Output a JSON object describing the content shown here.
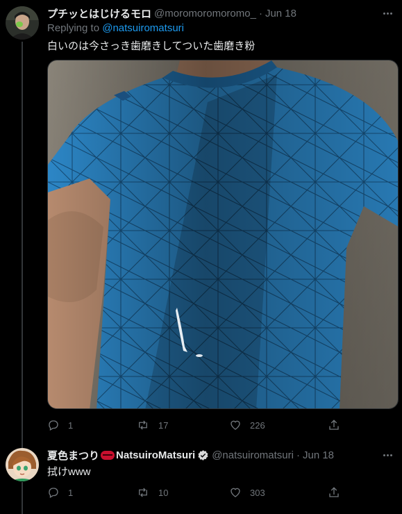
{
  "tweets": [
    {
      "display_name": "プチッとはじけるモロ",
      "handle": "@moromoromoromo_",
      "separator": "·",
      "date": "Jun 18",
      "replying_prefix": "Replying to",
      "replying_to": "@natsuiromatsuri",
      "text": "白いのは今さっき歯磨きしてついた歯磨き粉",
      "stats": {
        "replies": "1",
        "retweets": "17",
        "likes": "226"
      }
    },
    {
      "display_name_jp": "夏色まつり",
      "display_name_en": "NatsuiroMatsuri",
      "handle": "@natsuiromatsuri",
      "separator": "·",
      "date": "Jun 18",
      "text": "拭けwww",
      "stats": {
        "replies": "1",
        "retweets": "10",
        "likes": "303"
      }
    }
  ],
  "colors": {
    "background": "#000000",
    "text": "#e7e9ea",
    "muted": "#71767b",
    "link": "#1d9bf0",
    "shirt": "#2c86c6"
  },
  "icons": [
    "more-icon",
    "reply-icon",
    "retweet-icon",
    "like-icon",
    "share-icon",
    "verified-icon"
  ]
}
